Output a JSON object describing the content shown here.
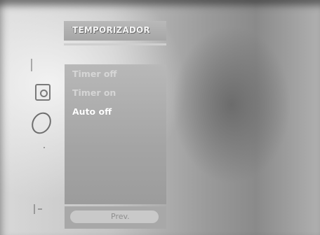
{
  "menu": {
    "title": "TEMPORIZADOR",
    "items": [
      {
        "label": "Timer off",
        "state": "normal"
      },
      {
        "label": "Timer on",
        "state": "normal"
      },
      {
        "label": "Auto off",
        "state": "selected"
      }
    ]
  },
  "footer": {
    "prev_label": "Prev."
  },
  "side_icons": [
    "bracket-icon",
    "timer-icon",
    "ring-icon",
    "dot-icon",
    "exit-icon"
  ],
  "colors": {
    "panel": "#a8a8a8",
    "text_normal": "#d8d8d8",
    "text_selected": "#ffffff"
  }
}
